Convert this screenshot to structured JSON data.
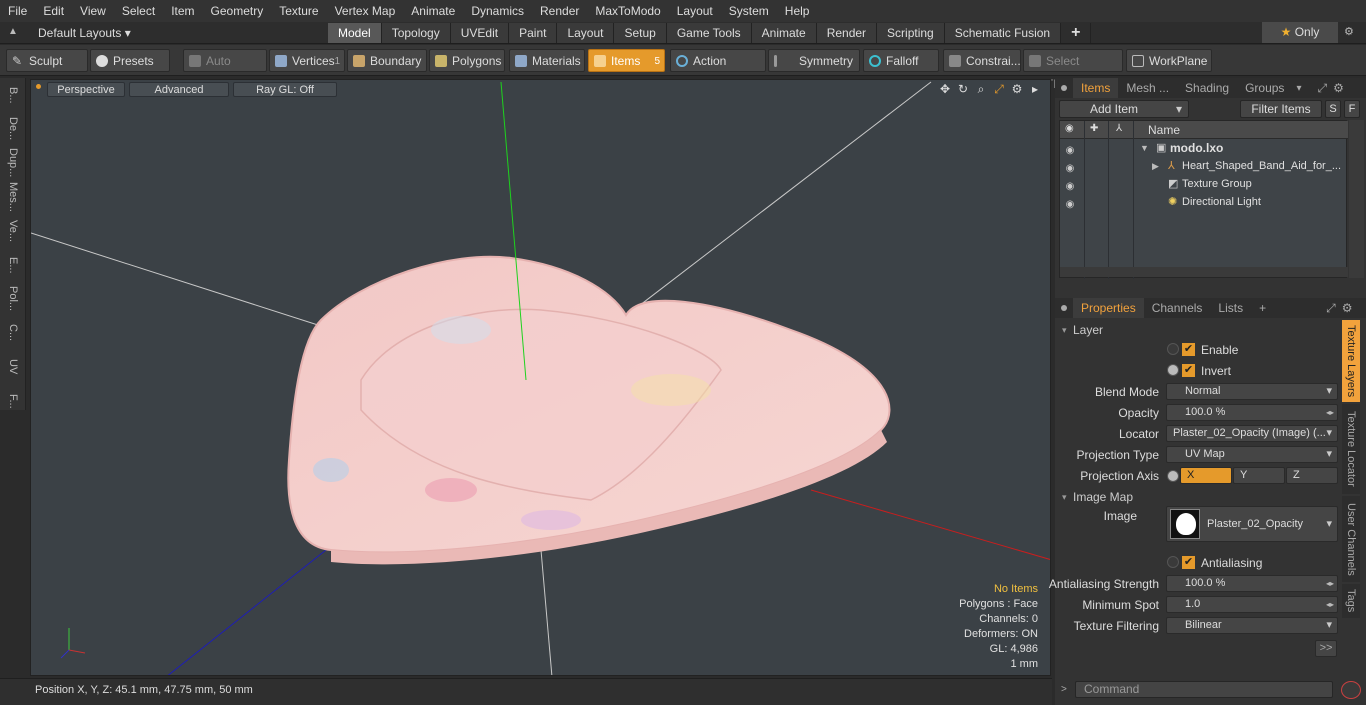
{
  "menu": [
    "File",
    "Edit",
    "View",
    "Select",
    "Item",
    "Geometry",
    "Texture",
    "Vertex Map",
    "Animate",
    "Dynamics",
    "Render",
    "MaxToModo",
    "Layout",
    "System",
    "Help"
  ],
  "layout": {
    "dropdown": "Default Layouts"
  },
  "tabs": [
    "Model",
    "Topology",
    "UVEdit",
    "Paint",
    "Layout",
    "Setup",
    "Game Tools",
    "Animate",
    "Render",
    "Scripting",
    "Schematic Fusion"
  ],
  "tabs_active": "Model",
  "only_label": "Only",
  "toolbar": {
    "sculpt": "Sculpt",
    "presets": "Presets",
    "auto_select": "Auto Select",
    "vertices": "Vertices",
    "vertices_count": "1",
    "boundary": "Boundary",
    "polygons": "Polygons",
    "materials": "Materials",
    "items": "Items",
    "items_count": "5",
    "action_center": "Action Center",
    "symmetry": "Symmetry",
    "falloff": "Falloff",
    "constraints": "Constrai...",
    "select_through": "Select Through",
    "workplane": "WorkPlane"
  },
  "left_tabs": [
    "B...",
    "De...",
    "Dup...",
    "Mes...",
    "Ve...",
    "E...",
    "Pol...",
    "C...",
    "UV",
    "F..."
  ],
  "viewport": {
    "perspective": "Perspective",
    "advanced": "Advanced",
    "raygl": "Ray GL: Off",
    "stats": {
      "no_items": "No Items",
      "polygons": "Polygons : Face",
      "channels": "Channels: 0",
      "deformers": "Deformers: ON",
      "gl": "GL: 4,986",
      "scale": "1 mm"
    }
  },
  "status": "Position X, Y, Z:   45.1 mm, 47.75 mm, 50 mm",
  "items_panel": {
    "tabs": [
      "Items",
      "Mesh ...",
      "Shading",
      "Groups"
    ],
    "add_item": "Add Item",
    "filter_items": "Filter Items",
    "s": "S",
    "f": "F",
    "name_header": "Name",
    "rows": [
      {
        "label": "modo.lxo"
      },
      {
        "label": "Heart_Shaped_Band_Aid_for_..."
      },
      {
        "label": "Texture Group"
      },
      {
        "label": "Directional Light"
      }
    ]
  },
  "properties": {
    "tabs": [
      "Properties",
      "Channels",
      "Lists"
    ],
    "layer_section": "Layer",
    "enable": "Enable",
    "invert": "Invert",
    "blend_mode_label": "Blend Mode",
    "blend_mode": "Normal",
    "opacity_label": "Opacity",
    "opacity": "100.0 %",
    "locator_label": "Locator",
    "locator": "Plaster_02_Opacity (Image) (...",
    "projection_type_label": "Projection Type",
    "projection_type": "UV Map",
    "projection_axis_label": "Projection Axis",
    "axis_x": "X",
    "axis_y": "Y",
    "axis_z": "Z",
    "image_map_section": "Image Map",
    "image_label": "Image",
    "image": "Plaster_02_Opacity",
    "antialiasing": "Antialiasing",
    "aa_strength_label": "Antialiasing Strength",
    "aa_strength": "100.0 %",
    "min_spot_label": "Minimum Spot",
    "min_spot": "1.0",
    "tex_filter_label": "Texture Filtering",
    "tex_filter": "Bilinear",
    "more": ">>",
    "vtabs": [
      "Texture Layers",
      "Texture Locator",
      "User Channels",
      "Tags"
    ]
  },
  "command_placeholder": "Command"
}
